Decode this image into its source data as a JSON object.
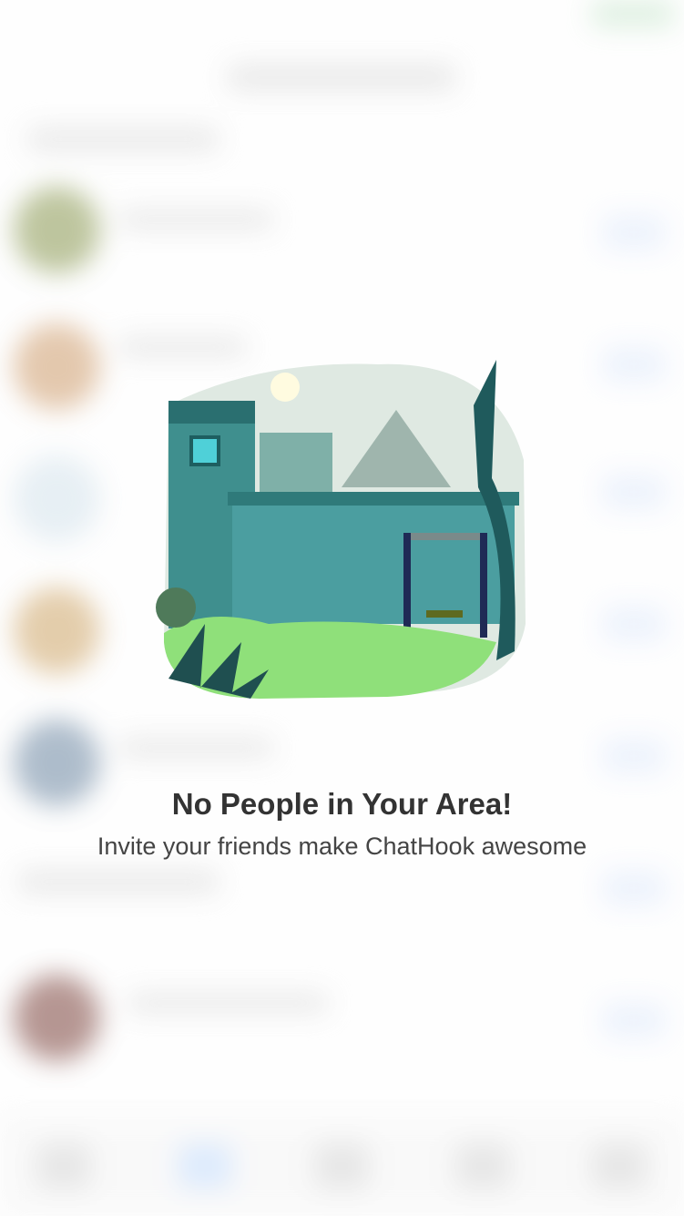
{
  "empty_state": {
    "title": "No People in Your Area!",
    "subtitle": "Invite your friends make ChatHook awesome",
    "illustration": "empty-backyard-illustration"
  },
  "background_avatar_colors": [
    "#7a8a3a",
    "#c8905a",
    "#cfe0ea",
    "#c89a55",
    "#5a7896",
    "#6a2a22"
  ],
  "accent": "#4a90e2"
}
